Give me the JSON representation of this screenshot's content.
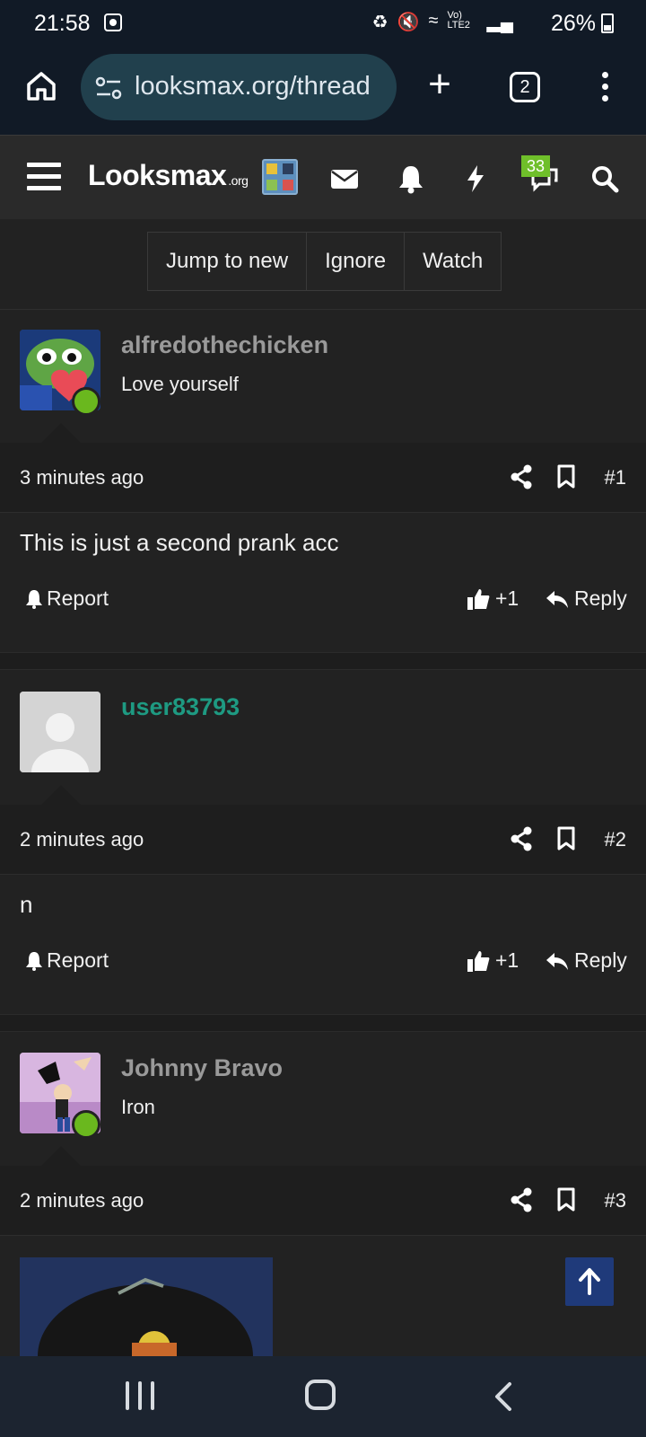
{
  "status_bar": {
    "time": "21:58",
    "network_label": "Vo) LTE2",
    "battery": "26%"
  },
  "browser": {
    "url": "looksmax.org/thread",
    "tab_count": "2"
  },
  "site": {
    "logo_text": "Looksmax",
    "logo_suffix": ".org",
    "notification_badge": "33"
  },
  "thread_buttons": [
    "Jump to new",
    "Ignore",
    "Watch"
  ],
  "posts": [
    {
      "username": "alfredothechicken",
      "user_title": "Love yourself",
      "time": "3 minutes ago",
      "number": "#1",
      "body": "This is just a second prank acc",
      "report": "Report",
      "likes": "+1",
      "reply": "Reply",
      "online": true
    },
    {
      "username": "user83793",
      "user_title": "",
      "time": "2 minutes ago",
      "number": "#2",
      "body": "n",
      "report": "Report",
      "likes": "+1",
      "reply": "Reply",
      "online": false
    },
    {
      "username": "Johnny Bravo",
      "user_title": "Iron",
      "time": "2 minutes ago",
      "number": "#3",
      "online": true
    }
  ],
  "colors": {
    "background": "#222222",
    "header": "#2a2a2a",
    "browser_bar": "#111a26",
    "online_dot": "#6ab81e",
    "teal_username": "#1e9a82",
    "badge_green": "#6fbf2a",
    "scroll_top_button": "#1f3a7a"
  }
}
